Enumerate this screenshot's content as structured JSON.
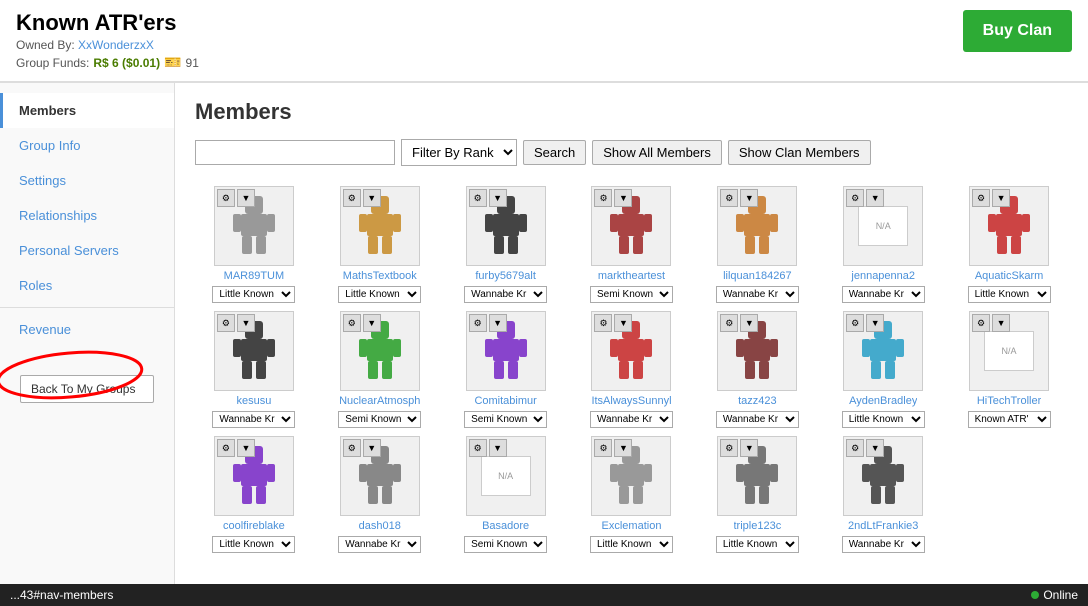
{
  "header": {
    "title": "Known ATR'ers",
    "owned_by_label": "Owned By:",
    "owner_name": "XxWonderzxX",
    "group_funds_label": "Group Funds:",
    "funds_amount": "R$ 6 ($0.01)",
    "funds_icon": "91",
    "buy_btn": "Buy Clan"
  },
  "sidebar": {
    "items": [
      {
        "label": "Members",
        "active": true,
        "id": "members"
      },
      {
        "label": "Group Info",
        "active": false,
        "id": "group-info"
      },
      {
        "label": "Settings",
        "active": false,
        "id": "settings"
      },
      {
        "label": "Relationships",
        "active": false,
        "id": "relationships"
      },
      {
        "label": "Personal Servers",
        "active": false,
        "id": "personal-servers"
      },
      {
        "label": "Roles",
        "active": false,
        "id": "roles"
      },
      {
        "label": "Revenue",
        "active": false,
        "id": "revenue"
      }
    ],
    "back_btn": "Back To My Groups"
  },
  "content": {
    "title": "Members",
    "search_placeholder": "",
    "filter_label": "Filter By Rank",
    "search_btn": "Search",
    "show_all_btn": "Show All Members",
    "show_clan_btn": "Show Clan Members"
  },
  "members": [
    {
      "name": "MAR89TUM",
      "rank": "Little Known",
      "avatar_color": "#999",
      "row": 0
    },
    {
      "name": "MathsTextbook",
      "rank": "Little Known",
      "avatar_color": "#c94",
      "row": 0
    },
    {
      "name": "furby5679alt",
      "rank": "Wannabe Kr",
      "avatar_color": "#444",
      "row": 0
    },
    {
      "name": "marktheartest",
      "rank": "Semi Known",
      "avatar_color": "#a44",
      "row": 0
    },
    {
      "name": "lilquan184267",
      "rank": "Wannabe Kr",
      "avatar_color": "#c84",
      "row": 0
    },
    {
      "name": "jennapenna2",
      "rank": "Wannabe Kr",
      "avatar_color": "#bbb",
      "row": 0,
      "na": true
    },
    {
      "name": "AquaticSkarm",
      "rank": "Little Known",
      "avatar_color": "#c44",
      "row": 0
    },
    {
      "name": "kesusu",
      "rank": "Wannabe Kr",
      "avatar_color": "#444",
      "row": 1
    },
    {
      "name": "NuclearAtmosph",
      "rank": "Semi Known",
      "avatar_color": "#4a4",
      "row": 1
    },
    {
      "name": "Comitabimur",
      "rank": "Semi Known",
      "avatar_color": "#84c",
      "row": 1
    },
    {
      "name": "ItsAlwaysSunnyl",
      "rank": "Wannabe Kr",
      "avatar_color": "#c44",
      "row": 1
    },
    {
      "name": "tazz423",
      "rank": "Wannabe Kr",
      "avatar_color": "#844",
      "row": 1
    },
    {
      "name": "AydenBradley",
      "rank": "Little Known",
      "avatar_color": "#4ac",
      "row": 1
    },
    {
      "name": "HiTechTroller",
      "rank": "Known ATR'",
      "avatar_color": "#bbb",
      "row": 1,
      "na": true
    },
    {
      "name": "coolfireblake",
      "rank": "Little Known",
      "avatar_color": "#84c",
      "row": 2
    },
    {
      "name": "dash018",
      "rank": "Wannabe Kr",
      "avatar_color": "#888",
      "row": 2
    },
    {
      "name": "Basadore",
      "rank": "Semi Known",
      "avatar_color": "#bbb",
      "row": 2,
      "na": true
    },
    {
      "name": "Exclemation",
      "rank": "Little Known",
      "avatar_color": "#999",
      "row": 2
    },
    {
      "name": "triple123c",
      "rank": "Little Known",
      "avatar_color": "#777",
      "row": 2
    },
    {
      "name": "2ndLtFrankie3",
      "rank": "Wannabe Kr",
      "avatar_color": "#555",
      "row": 2
    }
  ],
  "rank_options": [
    "Little Known",
    "Semi Known",
    "Wannabe Kr",
    "Known ATR'"
  ],
  "bottom_bar": {
    "url": "...43#nav-members",
    "online": "Online"
  }
}
